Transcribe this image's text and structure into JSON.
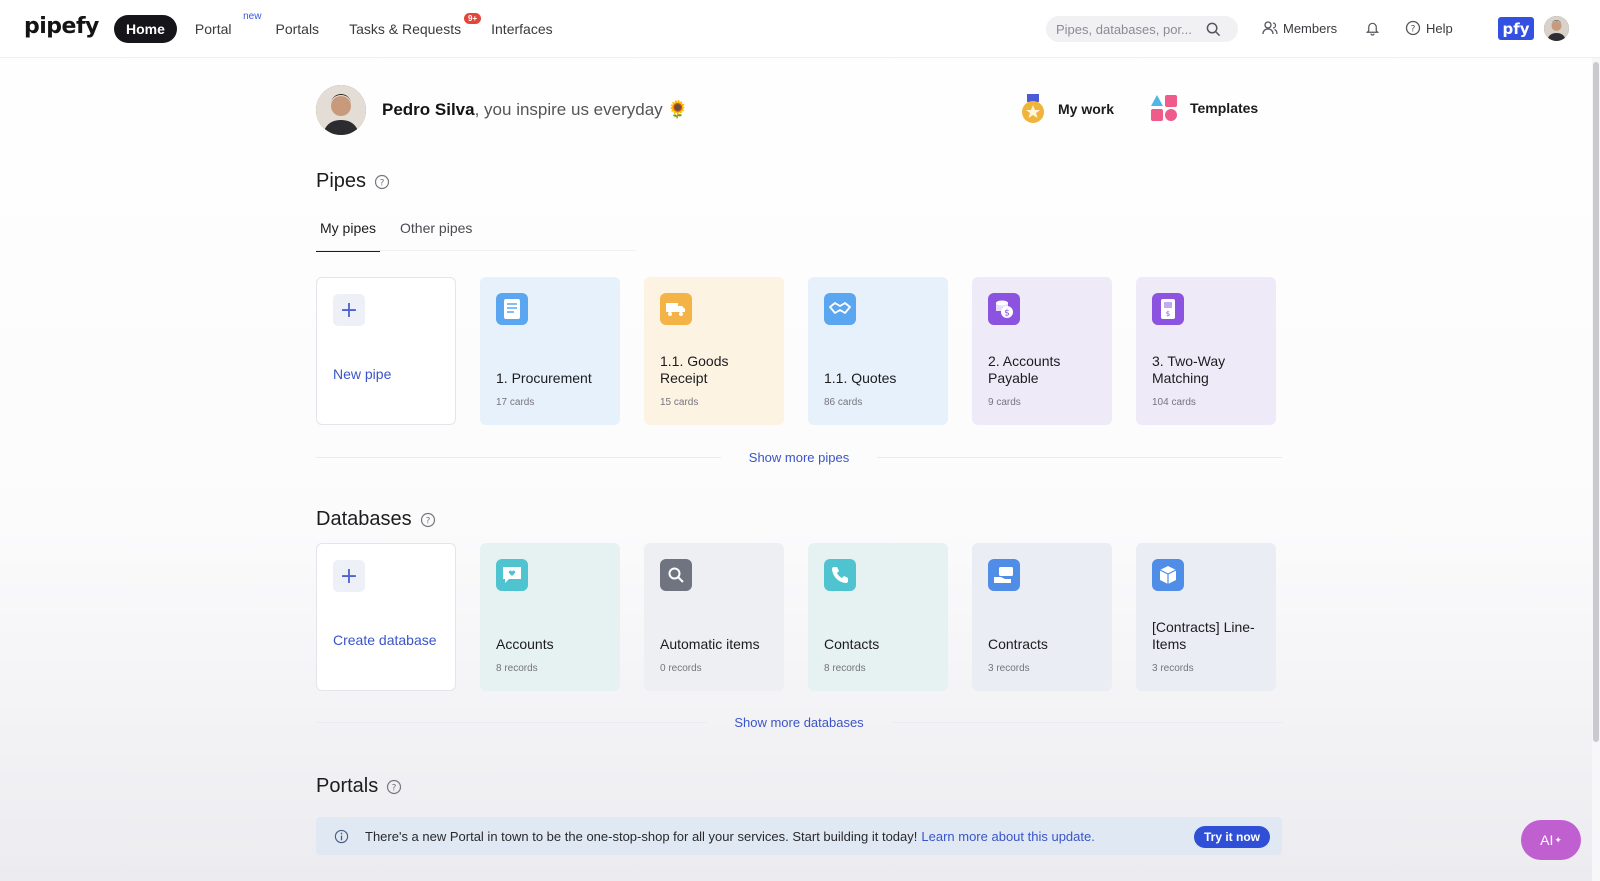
{
  "app": {
    "logo_text": "pipefy"
  },
  "nav": {
    "home": "Home",
    "portal": "Portal",
    "portal_badge": "new",
    "portals": "Portals",
    "tasks": "Tasks & Requests",
    "tasks_badge": "9+",
    "interfaces": "Interfaces"
  },
  "search": {
    "placeholder": "Pipes, databases, por..."
  },
  "top_right": {
    "members": "Members",
    "help": "Help",
    "badge": "pfy"
  },
  "greeting": {
    "name": "Pedro Silva",
    "message": ", you inspire us everyday",
    "emoji": "🌻"
  },
  "quick_links": {
    "my_work": "My work",
    "templates": "Templates"
  },
  "pipes": {
    "title": "Pipes",
    "tabs": [
      "My pipes",
      "Other pipes"
    ],
    "new_label": "New pipe",
    "items": [
      {
        "name": "1. Procurement",
        "count": "17 cards",
        "bg": "#e6f1fb",
        "icon_bg": "#5aa6f0",
        "icon": "document-icon"
      },
      {
        "name": "1.1. Goods Receipt",
        "count": "15 cards",
        "bg": "#fcf3e3",
        "icon_bg": "#f3b347",
        "icon": "truck-icon"
      },
      {
        "name": "1.1. Quotes",
        "count": "86 cards",
        "bg": "#e6f1fb",
        "icon_bg": "#5aa6f0",
        "icon": "handshake-icon"
      },
      {
        "name": "2. Accounts Payable",
        "count": "9 cards",
        "bg": "#efeaf8",
        "icon_bg": "#8b53df",
        "icon": "coins-icon"
      },
      {
        "name": "3. Two-Way Matching",
        "count": "104 cards",
        "bg": "#efeaf8",
        "icon_bg": "#8b53df",
        "icon": "receipt-icon"
      }
    ],
    "show_more": "Show more pipes"
  },
  "databases": {
    "title": "Databases",
    "new_label": "Create database",
    "items": [
      {
        "name": "Accounts",
        "count": "8 records",
        "bg": "#e6f1f1",
        "icon_bg": "#4fc4d0",
        "icon": "chat-heart-icon"
      },
      {
        "name": "Automatic items",
        "count": "0 records",
        "bg": "#eeeff2",
        "icon_bg": "#6f7480",
        "icon": "magnifier-icon"
      },
      {
        "name": "Contacts",
        "count": "8 records",
        "bg": "#e6f1f1",
        "icon_bg": "#4fc4d0",
        "icon": "phone-icon"
      },
      {
        "name": "Contracts",
        "count": "3 records",
        "bg": "#eaedf4",
        "icon_bg": "#4f8de6",
        "icon": "hand-card-icon"
      },
      {
        "name": "[Contracts] Line-Items",
        "count": "3 records",
        "bg": "#eaedf4",
        "icon_bg": "#4f8de6",
        "icon": "cube-icon"
      }
    ],
    "show_more": "Show more databases"
  },
  "portals": {
    "title": "Portals",
    "banner_text": "There's a new Portal in town to be the one-stop-shop for all your services. Start building it today!",
    "banner_link": "Learn more about this update.",
    "try_button": "Try it now"
  },
  "ai_button": "AI"
}
